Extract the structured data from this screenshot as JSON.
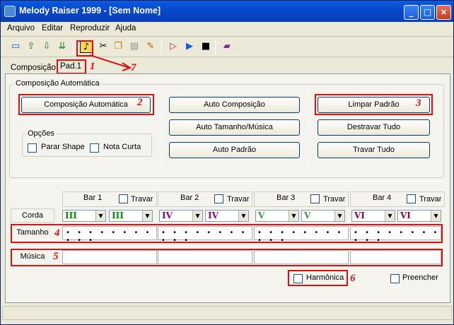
{
  "window": {
    "title": "Melody Raiser 1999 - [Sem Nome]"
  },
  "menu": [
    "Arquivo",
    "Editar",
    "Reproduzir",
    "Ajuda"
  ],
  "tabs": [
    {
      "label": "Composição"
    },
    {
      "label": "Pad.1"
    }
  ],
  "composicao_automatica": {
    "group_title": "Composição Automática",
    "buttons": {
      "composicao_automatica": "Composição Automática",
      "auto_composicao": "Auto Composição",
      "auto_tamanho_musica": "Auto Tamanho/Música",
      "auto_padrao": "Auto Padrão",
      "limpar_padrao": "Limpar Padrão",
      "destravar_tudo": "Destravar Tudo",
      "travar_tudo": "Travar Tudo"
    },
    "opcoes": {
      "title": "Opções",
      "parar_shape": "Parar Shape",
      "nota_curta": "Nota Curta"
    }
  },
  "bars": [
    {
      "label": "Bar 1",
      "travar": "Travar",
      "corda": [
        "III",
        "III"
      ]
    },
    {
      "label": "Bar 2",
      "travar": "Travar",
      "corda": [
        "IV",
        "IV"
      ]
    },
    {
      "label": "Bar 3",
      "travar": "Travar",
      "corda": [
        "V",
        "V"
      ]
    },
    {
      "label": "Bar 4",
      "travar": "Travar",
      "corda": [
        "VI",
        "VI"
      ]
    }
  ],
  "rows": {
    "corda": "Corda",
    "tamanho": "Tamanho",
    "musica": "Música"
  },
  "tamanho_dots": "• • • • • • • • • • •",
  "bottom": {
    "harmonica": "Harmônica",
    "preencher": "Preencher"
  },
  "annotations": [
    "1",
    "2",
    "3",
    "4",
    "5",
    "6",
    "7"
  ],
  "colors": {
    "annotation": "#e01010",
    "chord_colors": [
      "#0a8a0a",
      "#0a8a0a",
      "#7a0a7a",
      "#7a0a7a",
      "#3a9a3a",
      "#3a9a3a",
      "#8a0a3a",
      "#8a0a3a"
    ]
  }
}
